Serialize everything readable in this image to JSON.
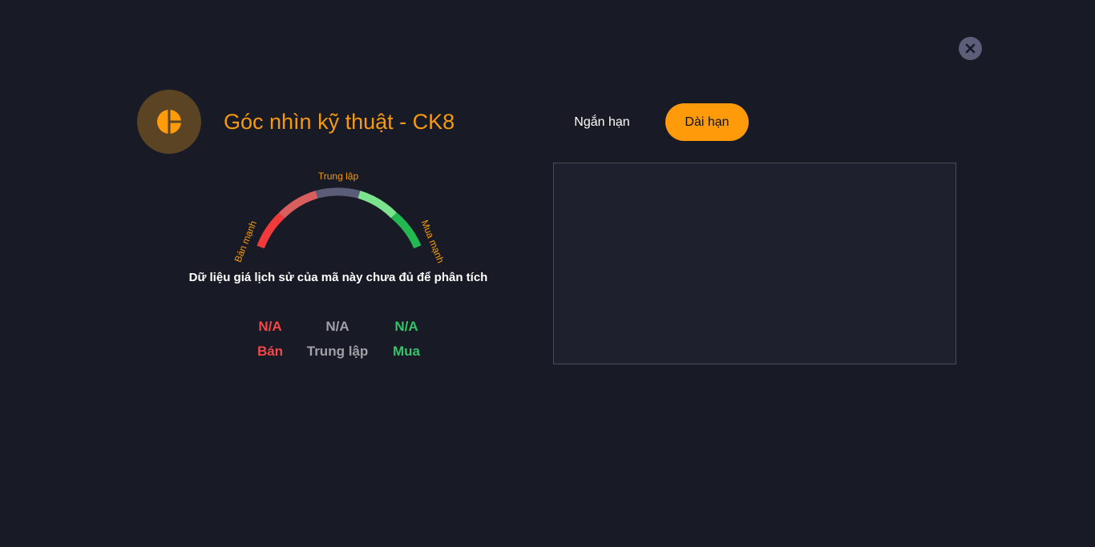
{
  "header": {
    "title": "Góc nhìn kỹ thuật - CK8",
    "logo_icon": "pie-chart-icon",
    "close_icon": "close-icon"
  },
  "tabs": [
    {
      "label": "Ngắn hạn",
      "active": false
    },
    {
      "label": "Dài hạn",
      "active": true
    }
  ],
  "gauge": {
    "label_left": "Bán mạnh",
    "label_top": "Trung lập",
    "label_right": "Mua mạnh",
    "segment_colors": [
      "#f23a3a",
      "#d95f5f",
      "#5a5c78",
      "#7be38e",
      "#23b852"
    ],
    "message": "Dữ liệu giá lịch sử của mã này chưa đủ để phân tích"
  },
  "summary": {
    "sell": {
      "value": "N/A",
      "label": "Bán",
      "color": "#f24848"
    },
    "neutral": {
      "value": "N/A",
      "label": "Trung lập",
      "color": "#9fa0a8"
    },
    "buy": {
      "value": "N/A",
      "label": "Mua",
      "color": "#34c468"
    }
  },
  "colors": {
    "background": "#181a25",
    "accent": "#ff9a0a",
    "panel": "#1f202d"
  }
}
